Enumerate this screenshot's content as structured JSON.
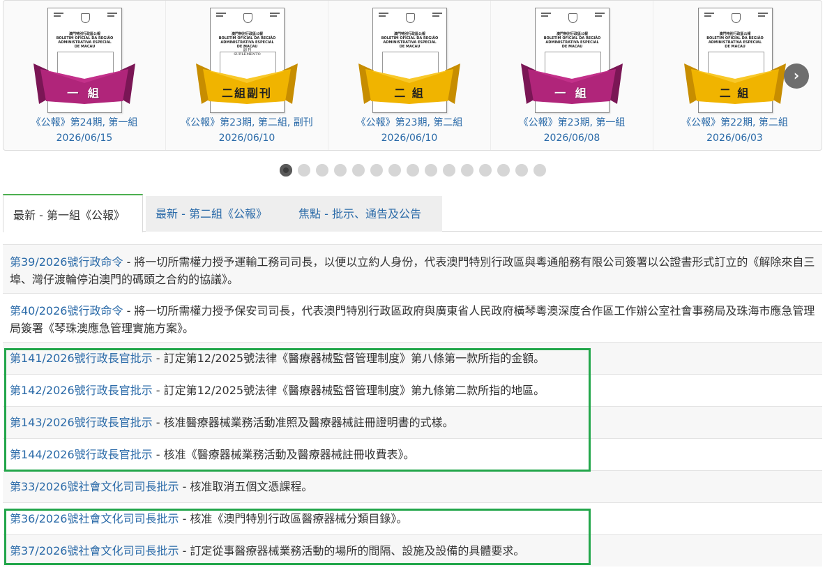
{
  "carousel": {
    "slides": [
      {
        "title": "《公報》第24期, 第一組",
        "date": "2026/06/15",
        "band": "一 組",
        "band_color": "#b0257a",
        "band_type": "magenta"
      },
      {
        "title": "《公報》第23期, 第二組, 副刊",
        "date": "2026/06/10",
        "band": "二組副刊",
        "band_color": "#f0b400",
        "band_type": "gold",
        "suplemento": "副 刊\nSUPLEMENTO"
      },
      {
        "title": "《公報》第23期, 第二組",
        "date": "2026/06/10",
        "band": "二 組",
        "band_color": "#f0b400",
        "band_type": "gold"
      },
      {
        "title": "《公報》第23期, 第一組",
        "date": "2026/06/08",
        "band": "一 組",
        "band_color": "#b0257a",
        "band_type": "magenta"
      },
      {
        "title": "《公報》第22期, 第二組",
        "date": "2026/06/03",
        "band": "二 組",
        "band_color": "#f0b400",
        "band_type": "gold"
      }
    ],
    "cover_heading": "澳門特別行政區公報\nBOLETIM OFICIAL DA REGIÃO\nADMINISTRATIVA ESPECIAL DE MACAU",
    "next_label": "›",
    "dot_count": 15,
    "active_dot": 1
  },
  "tabs": [
    {
      "label": "最新 - 第一組《公報》",
      "active": true
    },
    {
      "label": "最新 - 第二組《公報》",
      "active": false
    },
    {
      "label": "焦點 - 批示、通告及公告",
      "active": false
    }
  ],
  "list": [
    {
      "link": "第39/2026號行政命令",
      "text": " - 將一切所需權力授予運輸工務司司長，以便以立約人身份，代表澳門特別行政區與粵通船務有限公司簽署以公證書形式訂立的《解除來自三埠、灣仔渡輪停泊澳門的碼頭之合約的協議》。",
      "double": true
    },
    {
      "link": "第40/2026號行政命令",
      "text": " - 將一切所需權力授予保安司司長，代表澳門特別行政區政府與廣東省人民政府橫琴粵澳深度合作區工作辦公室社會事務局及珠海市應急管理局簽署《琴珠澳應急管理實施方案》。",
      "double": true
    },
    {
      "link": "第141/2026號行政長官批示",
      "text": " - 訂定第12/2025號法律《醫療器械監督管理制度》第八條第一款所指的金額。",
      "double": false
    },
    {
      "link": "第142/2026號行政長官批示",
      "text": " - 訂定第12/2025號法律《醫療器械監督管理制度》第九條第二款所指的地區。",
      "double": false
    },
    {
      "link": "第143/2026號行政長官批示",
      "text": " - 核准醫療器械業務活動准照及醫療器械註冊證明書的式樣。",
      "double": false
    },
    {
      "link": "第144/2026號行政長官批示",
      "text": " - 核准《醫療器械業務活動及醫療器械註冊收費表》。",
      "double": false
    },
    {
      "link": "第33/2026號社會文化司司長批示",
      "text": " - 核准取消五個文憑課程。",
      "double": false
    },
    {
      "link": "第36/2026號社會文化司司長批示",
      "text": " - 核准《澳門特別行政區醫療器械分類目錄》。",
      "double": false
    },
    {
      "link": "第37/2026號社會文化司司長批示",
      "text": " - 訂定從事醫療器械業務活動的場所的間隔、設施及設備的具體要求。",
      "double": false
    }
  ],
  "highlight_color": "#22a64a"
}
